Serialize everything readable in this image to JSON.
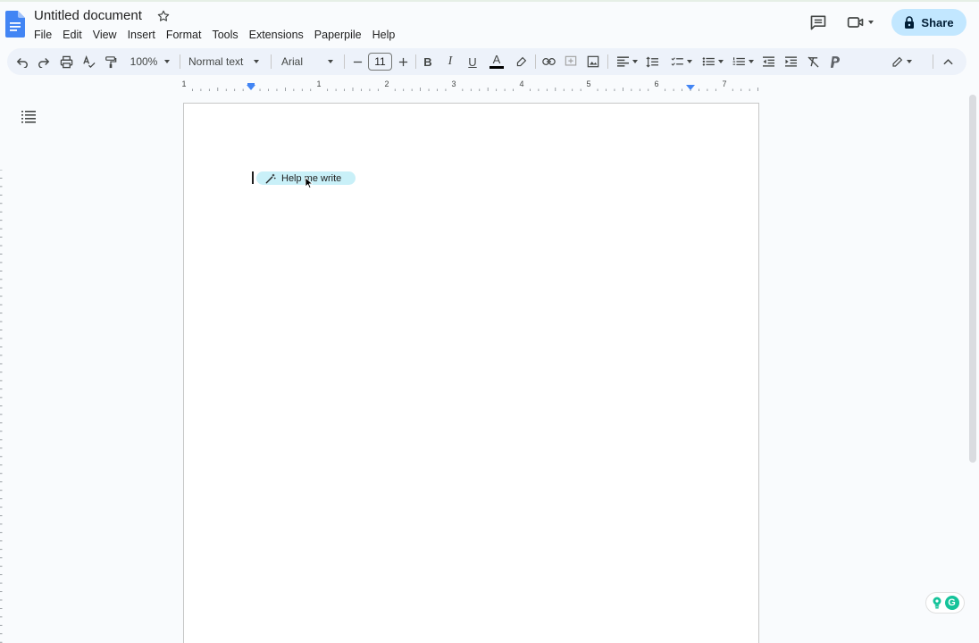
{
  "document": {
    "title": "Untitled document"
  },
  "menu": [
    "File",
    "Edit",
    "View",
    "Insert",
    "Format",
    "Tools",
    "Extensions",
    "Paperpile",
    "Help"
  ],
  "header": {
    "share_label": "Share"
  },
  "toolbar": {
    "zoom": "100%",
    "style": "Normal text",
    "font": "Arial",
    "font_size": "11",
    "bold_label": "B",
    "italic_label": "I",
    "underline_label": "U",
    "text_color_label": "A"
  },
  "ruler": {
    "numbers": [
      "1",
      "1",
      "2",
      "3",
      "4",
      "5",
      "6",
      "7"
    ]
  },
  "editor": {
    "help_me_write": "Help me write"
  },
  "grammarly": {
    "label": "G"
  },
  "colors": {
    "share_bg": "#c2e7ff",
    "toolbar_bg": "#edf2fa",
    "chip_bg": "#c9f0f8",
    "accent": "#4285f4",
    "grammarly": "#15c39a"
  }
}
